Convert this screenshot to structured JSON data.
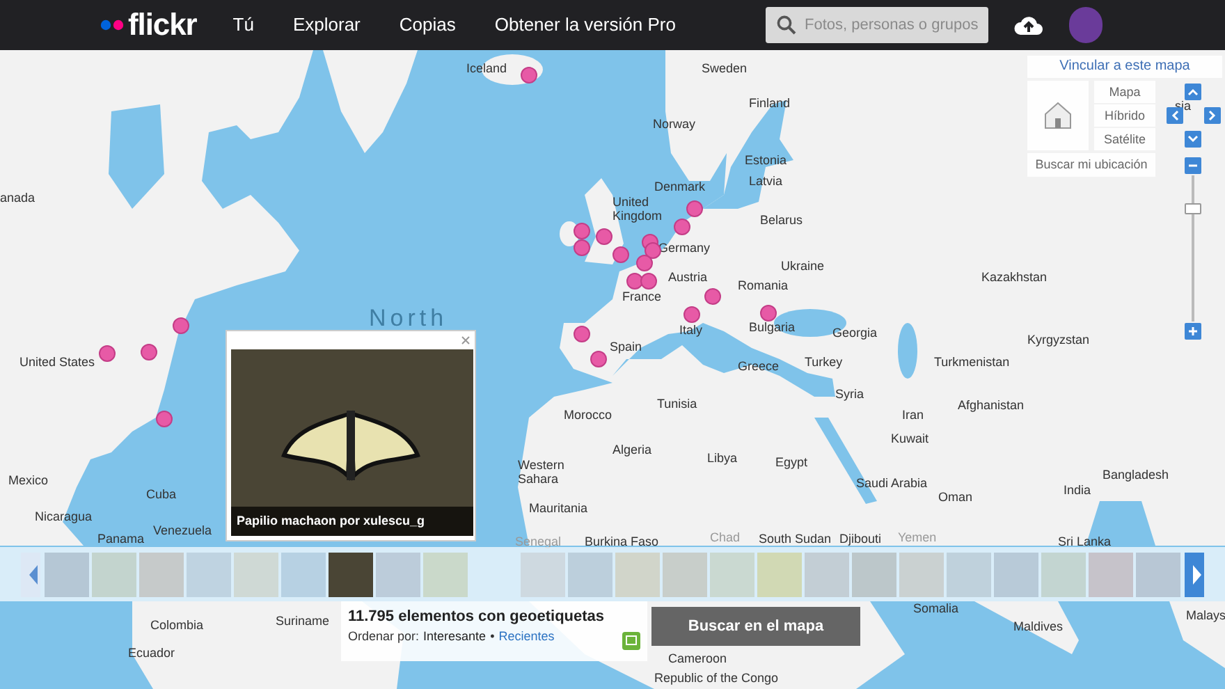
{
  "header": {
    "logo": "flickr",
    "nav": [
      {
        "label": "Tú"
      },
      {
        "label": "Explorar"
      },
      {
        "label": "Copias"
      },
      {
        "label": "Obtener la versión Pro"
      }
    ],
    "search": {
      "placeholder": "Fotos, personas o grupos"
    }
  },
  "map": {
    "labels": [
      "Iceland",
      "Sweden",
      "Finland",
      "Norway",
      "Estonia",
      "Latvia",
      "Denmark",
      "United Kingdom",
      "Belarus",
      "Germany",
      "Ukraine",
      "France",
      "Austria",
      "Romania",
      "Kazakhstan",
      "Italy",
      "Bulgaria",
      "Spain",
      "Greece",
      "Georgia",
      "Turkey",
      "Turkmenistan",
      "Kyrgyzstan",
      "Afghanistan",
      "Iran",
      "Syria",
      "Tunisia",
      "Morocco",
      "Western Sahara",
      "Algeria",
      "Libya",
      "Egypt",
      "Kuwait",
      "Saudi Arabia",
      "Oman",
      "India",
      "Bangladesh",
      "Mauritania",
      "Mexico",
      "Cuba",
      "United States",
      "anada",
      "sia",
      "Nicaragua",
      "Venezuela",
      "Panama",
      "Senegal",
      "Burkina Faso",
      "Chad",
      "South Sudan",
      "Djibouti",
      "Yemen",
      "Sri Lanka",
      "Colombia",
      "Suriname",
      "Ecuador",
      "Cameroon",
      "Republic of the Congo",
      "Somalia",
      "Maldives",
      "Malays"
    ],
    "ocean_label": "North",
    "popup": {
      "caption": "Papilio machaon por xulescu_g"
    }
  },
  "controls": {
    "link": "Vincular a este mapa",
    "map_types": [
      {
        "label": "Mapa"
      },
      {
        "label": "Híbrido"
      },
      {
        "label": "Satélite"
      }
    ],
    "locate": "Buscar mi ubicación",
    "zoom": {
      "level": 0.79
    }
  },
  "filmstrip": {
    "thumbnails": [
      {
        "selected": false
      },
      {
        "selected": false
      },
      {
        "selected": false
      },
      {
        "selected": false
      },
      {
        "selected": false
      },
      {
        "selected": false
      },
      {
        "selected": true
      },
      {
        "selected": false
      },
      {
        "selected": false
      },
      {
        "selected": false
      },
      {
        "selected": false
      },
      {
        "selected": false
      },
      {
        "selected": false
      },
      {
        "selected": false
      },
      {
        "selected": false
      },
      {
        "selected": false
      },
      {
        "selected": false
      },
      {
        "selected": false
      },
      {
        "selected": false
      },
      {
        "selected": false
      },
      {
        "selected": false
      },
      {
        "selected": false
      },
      {
        "selected": false
      }
    ]
  },
  "info": {
    "count": "11.795 elementos con geoetiquetas",
    "sort_label": "Ordenar por:",
    "sort_options": [
      {
        "label": "Interesante",
        "selected": true
      },
      {
        "label": "Recientes",
        "selected": false
      }
    ],
    "separator": "•"
  },
  "search_button": "Buscar en el mapa"
}
